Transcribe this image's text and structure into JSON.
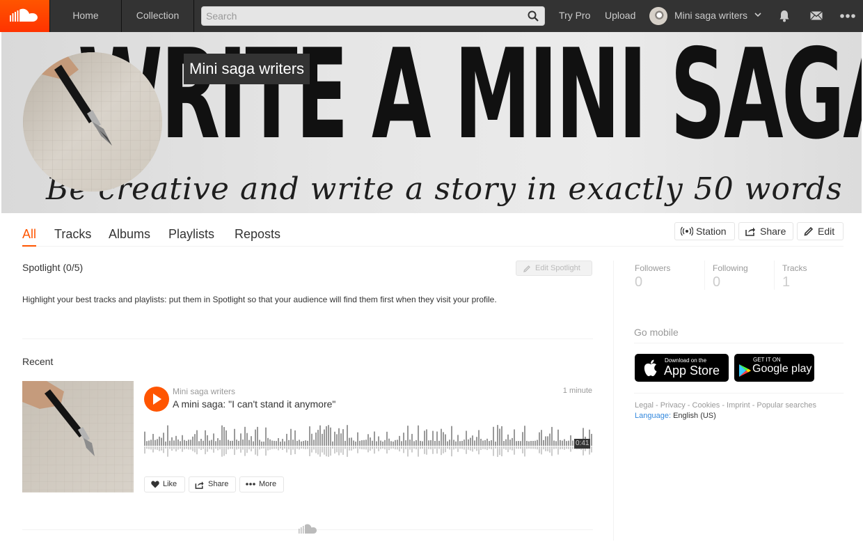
{
  "nav": {
    "home": "Home",
    "collection": "Collection",
    "search_placeholder": "Search",
    "try_pro": "Try Pro",
    "upload": "Upload",
    "user_name": "Mini saga writers"
  },
  "banner": {
    "headline": "WRITE A MINI SAGA",
    "tagline": "Be creative and write a story in exactly 50 words",
    "profile_name": "Mini saga writers"
  },
  "tabs": [
    "All",
    "Tracks",
    "Albums",
    "Playlists",
    "Reposts"
  ],
  "active_tab": "All",
  "actions": {
    "station": "Station",
    "share": "Share",
    "edit": "Edit"
  },
  "spotlight": {
    "title": "Spotlight (0/5)",
    "edit_button": "Edit Spotlight",
    "description": "Highlight your best tracks and playlists: put them in Spotlight so that your audience will find them first when they visit your profile."
  },
  "recent": {
    "title": "Recent",
    "track": {
      "user": "Mini saga writers",
      "title": "A mini saga: \"I can't stand it anymore\"",
      "posted": "1 minute",
      "duration": "0:41",
      "like": "Like",
      "share": "Share",
      "more": "More"
    }
  },
  "stats": [
    {
      "label": "Followers",
      "value": "0"
    },
    {
      "label": "Following",
      "value": "0"
    },
    {
      "label": "Tracks",
      "value": "1"
    }
  ],
  "sidebar": {
    "go_mobile": "Go mobile",
    "app_store_small": "Download on the",
    "app_store_big": "App Store",
    "google_small": "GET IT ON",
    "google_big": "Google play",
    "footer_links": "Legal - Privacy - Cookies - Imprint - Popular searches",
    "language_label": "Language:",
    "language_value": "English (US)"
  },
  "colors": {
    "accent": "#ff5500",
    "topbar": "#333333",
    "link_blue": "#3388dd"
  },
  "icons": [
    "soundcloud-logo-icon",
    "search-icon",
    "chevron-down-icon",
    "bell-icon",
    "mail-icon",
    "more-dots-icon",
    "station-icon",
    "share-icon",
    "pencil-icon",
    "play-icon",
    "heart-icon",
    "ellipsis-icon",
    "apple-icon",
    "google-play-icon",
    "soundcloud-cloud-icon"
  ]
}
